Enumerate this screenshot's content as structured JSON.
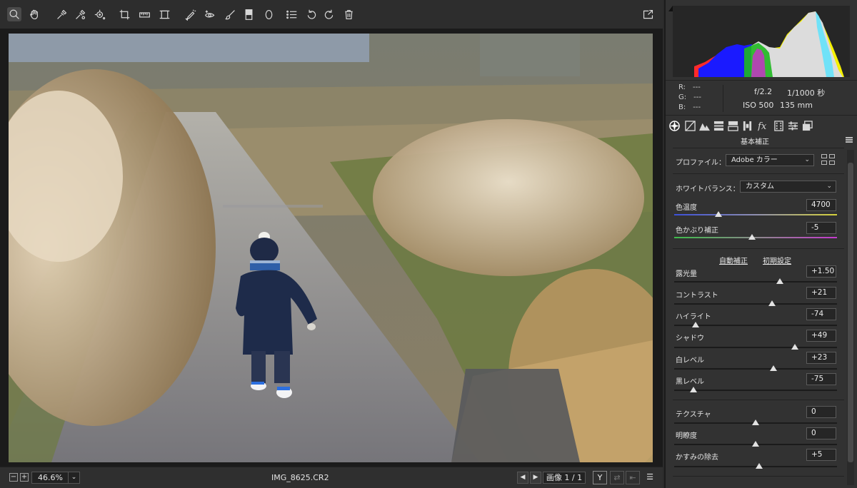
{
  "bottom_bar": {
    "zoom": "46.6%",
    "zoom_out": "−",
    "zoom_in": "+",
    "filename": "IMG_8625.CR2",
    "prev": "◀",
    "next": "▶",
    "image_counter": "画像 1 / 1",
    "view_toggle": "Y",
    "compare_btn": "⇄",
    "swap_btn": "⇤",
    "settings_btn": "☰"
  },
  "info": {
    "r_label": "R:",
    "r_value": "---",
    "g_label": "G:",
    "g_value": "---",
    "b_label": "B:",
    "b_value": "---",
    "aperture": "f/2.2",
    "shutter": "1/1000 秒",
    "iso": "ISO 500",
    "focal": "135 mm"
  },
  "panel": {
    "title": "基本補正",
    "profile_label": "プロファイル：",
    "profile_value": "Adobe カラー",
    "wb_label": "ホワイトバランス：",
    "wb_value": "カスタム",
    "auto_link": "自動補正",
    "default_link": "初期設定"
  },
  "sliders": {
    "temp": {
      "label": "色温度",
      "value": "4700",
      "position": 0.27
    },
    "tint": {
      "label": "色かぶり補正",
      "value": "-5",
      "position": 0.48
    },
    "exposure": {
      "label": "露光量",
      "value": "+1.50",
      "position": 0.65
    },
    "contrast": {
      "label": "コントラスト",
      "value": "+21",
      "position": 0.6
    },
    "highlights": {
      "label": "ハイライト",
      "value": "-74",
      "position": 0.13
    },
    "shadows": {
      "label": "シャドウ",
      "value": "+49",
      "position": 0.74
    },
    "whites": {
      "label": "白レベル",
      "value": "+23",
      "position": 0.61
    },
    "blacks": {
      "label": "黒レベル",
      "value": "-75",
      "position": 0.12
    },
    "texture": {
      "label": "テクスチャ",
      "value": "0",
      "position": 0.5
    },
    "clarity": {
      "label": "明瞭度",
      "value": "0",
      "position": 0.5
    },
    "dehaze": {
      "label": "かすみの除去",
      "value": "+5",
      "position": 0.52
    }
  },
  "icons": {
    "tools": [
      "zoom-icon",
      "hand-icon",
      "white-balance-icon",
      "color-sampler-icon",
      "target-adjust-icon",
      "crop-icon",
      "straighten-icon",
      "transform-icon",
      "spot-removal-icon",
      "red-eye-icon",
      "adjustment-brush-icon",
      "graduated-filter-icon",
      "radial-filter-icon",
      "preferences-icon",
      "rotate-left-icon",
      "rotate-right-icon",
      "trash-icon",
      "fullscreen-icon"
    ],
    "panel_tabs": [
      "basic-tab-icon",
      "tone-curve-tab-icon",
      "detail-tab-icon",
      "hsl-tab-icon",
      "split-toning-tab-icon",
      "lens-tab-icon",
      "effects-tab-icon",
      "calibration-tab-icon",
      "presets-tab-icon",
      "snapshots-tab-icon"
    ]
  }
}
